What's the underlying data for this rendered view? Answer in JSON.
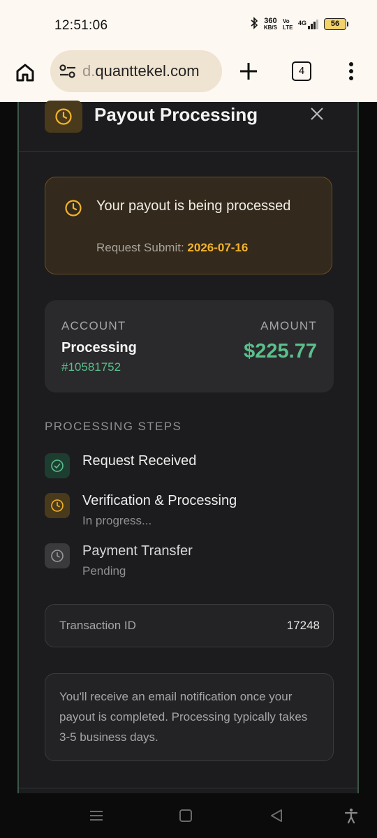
{
  "status_bar": {
    "time": "12:51:06",
    "speed": "360",
    "speed_unit": "KB/S",
    "network": "4G",
    "volte": "Vo LTE",
    "battery": "56"
  },
  "browser": {
    "url_prefix": "d.",
    "url_main": "quanttekel.com",
    "tab_count": "4"
  },
  "modal": {
    "title": "Payout Processing",
    "alert": {
      "title": "Your payout is being processed",
      "sub_label": "Request Submit:",
      "date": "2026-07-16"
    },
    "account": {
      "account_label": "ACCOUNT",
      "amount_label": "AMOUNT",
      "name": "Processing",
      "number": "#10581752",
      "amount": "$225.77"
    },
    "steps_title": "PROCESSING STEPS",
    "steps": [
      {
        "title": "Request Received",
        "subtitle": "",
        "state": "done"
      },
      {
        "title": "Verification & Processing",
        "subtitle": "In progress...",
        "state": "progress"
      },
      {
        "title": "Payment Transfer",
        "subtitle": "Pending",
        "state": "pending"
      }
    ],
    "transaction": {
      "label": "Transaction ID",
      "value": "17248"
    },
    "note": "You'll receive an email notification once your payout is completed. Processing typically takes 3-5 business days."
  },
  "colors": {
    "accent_green": "#5bbf8c",
    "accent_amber": "#f3b42b",
    "background": "#1c1c1e"
  }
}
